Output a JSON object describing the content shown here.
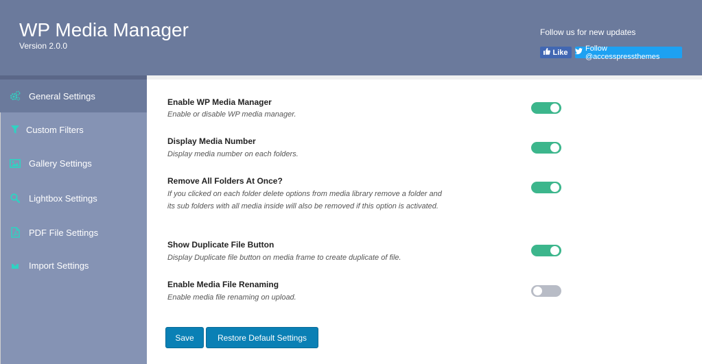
{
  "header": {
    "title": "WP Media Manager",
    "version": "Version 2.0.0",
    "follow_text": "Follow us for new updates",
    "like_label": "Like",
    "twitter_label": "Follow @accesspressthemes"
  },
  "sidebar": {
    "items": [
      {
        "label": "General Settings",
        "icon": "gears-icon",
        "active": true
      },
      {
        "label": "Custom Filters",
        "icon": "filter-icon",
        "active": false
      },
      {
        "label": "Gallery Settings",
        "icon": "image-icon",
        "active": false
      },
      {
        "label": "Lightbox Settings",
        "icon": "search-icon",
        "active": false
      },
      {
        "label": "PDF File Settings",
        "icon": "pdf-file-icon",
        "active": false
      },
      {
        "label": "Import Settings",
        "icon": "import-icon",
        "active": false
      }
    ]
  },
  "settings": [
    {
      "title": "Enable WP Media Manager",
      "desc": "Enable or disable WP media manager.",
      "enabled": true
    },
    {
      "title": "Display Media Number",
      "desc": "Display media number on each folders.",
      "enabled": true
    },
    {
      "title": "Remove All Folders At Once?",
      "desc": "If you clicked on each folder delete options from media library remove a folder and its sub folders with all media inside will also be removed if this option is activated.",
      "enabled": true
    },
    {
      "title": "Show Duplicate File Button",
      "desc": "Display Duplicate file button on media frame to create duplicate of file.",
      "enabled": true
    },
    {
      "title": "Enable Media File Renaming",
      "desc": "Enable media file renaming on upload.",
      "enabled": false
    }
  ],
  "actions": {
    "save_label": "Save",
    "restore_label": "Restore Default Settings"
  },
  "colors": {
    "header": "#6b7a9c",
    "sidebar": "#8593b4",
    "toggle_on": "#3cb68c",
    "toggle_off": "#b8bcc6",
    "button": "#0a80b5",
    "icon_accent": "#2fd3c2"
  }
}
